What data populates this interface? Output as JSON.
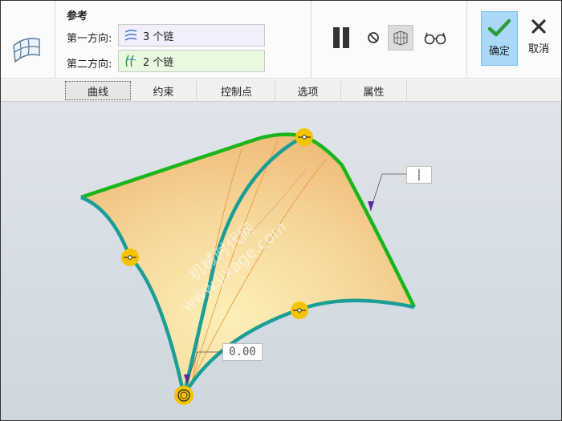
{
  "ribbon": {
    "section_title": "参考",
    "direction1": {
      "label": "第一方向:",
      "value": "3 个链"
    },
    "direction2": {
      "label": "第二方向:",
      "value": "2 个链"
    },
    "ok_label": "确定",
    "cancel_label": "取消"
  },
  "tabs": [
    {
      "label": "曲线",
      "active": true
    },
    {
      "label": "约束",
      "active": false
    },
    {
      "label": "控制点",
      "active": false
    },
    {
      "label": "选项",
      "active": false
    },
    {
      "label": "属性",
      "active": false
    }
  ],
  "viewport": {
    "callout_top_text": "|",
    "callout_bottom_text": "0.00",
    "watermark_line1": "机械时代网",
    "watermark_line2": "www.jixage.com"
  },
  "colors": {
    "surface": "#f4c98a",
    "teal_curve": "#1a9e96",
    "green_curve": "#19b51a",
    "handle": "#f5c400",
    "ok_bg": "#a9d9f7"
  }
}
